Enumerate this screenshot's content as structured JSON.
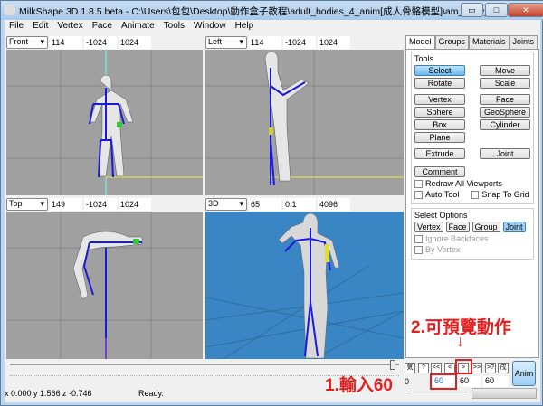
{
  "window": {
    "title": "MilkShape 3D 1.8.5 beta - C:\\Users\\包包\\Desktop\\動作盒子教程\\adult_bodies_4_anim[成人骨骼模型]\\am_body_4_anim...",
    "minimize": "▭",
    "maximize": "□",
    "close": "✕"
  },
  "menu": [
    "File",
    "Edit",
    "Vertex",
    "Face",
    "Animate",
    "Tools",
    "Window",
    "Help"
  ],
  "viewports": [
    {
      "view": "Front",
      "v1": "114",
      "v2": "-1024",
      "v3": "1024"
    },
    {
      "view": "Left",
      "v1": "114",
      "v2": "-1024",
      "v3": "1024"
    },
    {
      "view": "Top",
      "v1": "149",
      "v2": "-1024",
      "v3": "1024"
    },
    {
      "view": "3D",
      "v1": "65",
      "v2": "0.1",
      "v3": "4096"
    }
  ],
  "panel": {
    "tabs": [
      "Model",
      "Groups",
      "Materials",
      "Joints"
    ],
    "tools_label": "Tools",
    "tools": [
      [
        "Select",
        "Move"
      ],
      [
        "Rotate",
        "Scale"
      ],
      [
        "Vertex",
        "Face"
      ],
      [
        "Sphere",
        "GeoSphere"
      ],
      [
        "Box",
        "Cylinder"
      ],
      [
        "Plane"
      ],
      [
        "Extrude",
        "Joint"
      ],
      [
        "Comment"
      ]
    ],
    "redraw": "Redraw All Viewports",
    "auto_tool": "Auto Tool",
    "snap": "Snap To Grid",
    "select_options_label": "Select Options",
    "select_opts": [
      "Vertex",
      "Face",
      "Group",
      "Joint"
    ],
    "ignore_backfaces": "Ignore Backfaces",
    "by_vertex": "By Vertex"
  },
  "anim": {
    "buttons": [
      "気",
      "?",
      "<<",
      "<",
      ">",
      ">>",
      ">?",
      "戌"
    ],
    "frame": "60",
    "frame2": "60",
    "frame3": "60",
    "start": "0",
    "anim_label": "Anim"
  },
  "status": {
    "coords": "x 0.000 y 1.566 z -0.746",
    "text": "Ready."
  },
  "annotations": {
    "step1": "1.輸入60",
    "step2": "2.可預覽動作",
    "arrow": "↓"
  },
  "colors": {
    "viewport": "#a0a0a0",
    "viewport3d": "#3a86c4",
    "bone": "#1a1adc",
    "annotation": "#e02020"
  }
}
